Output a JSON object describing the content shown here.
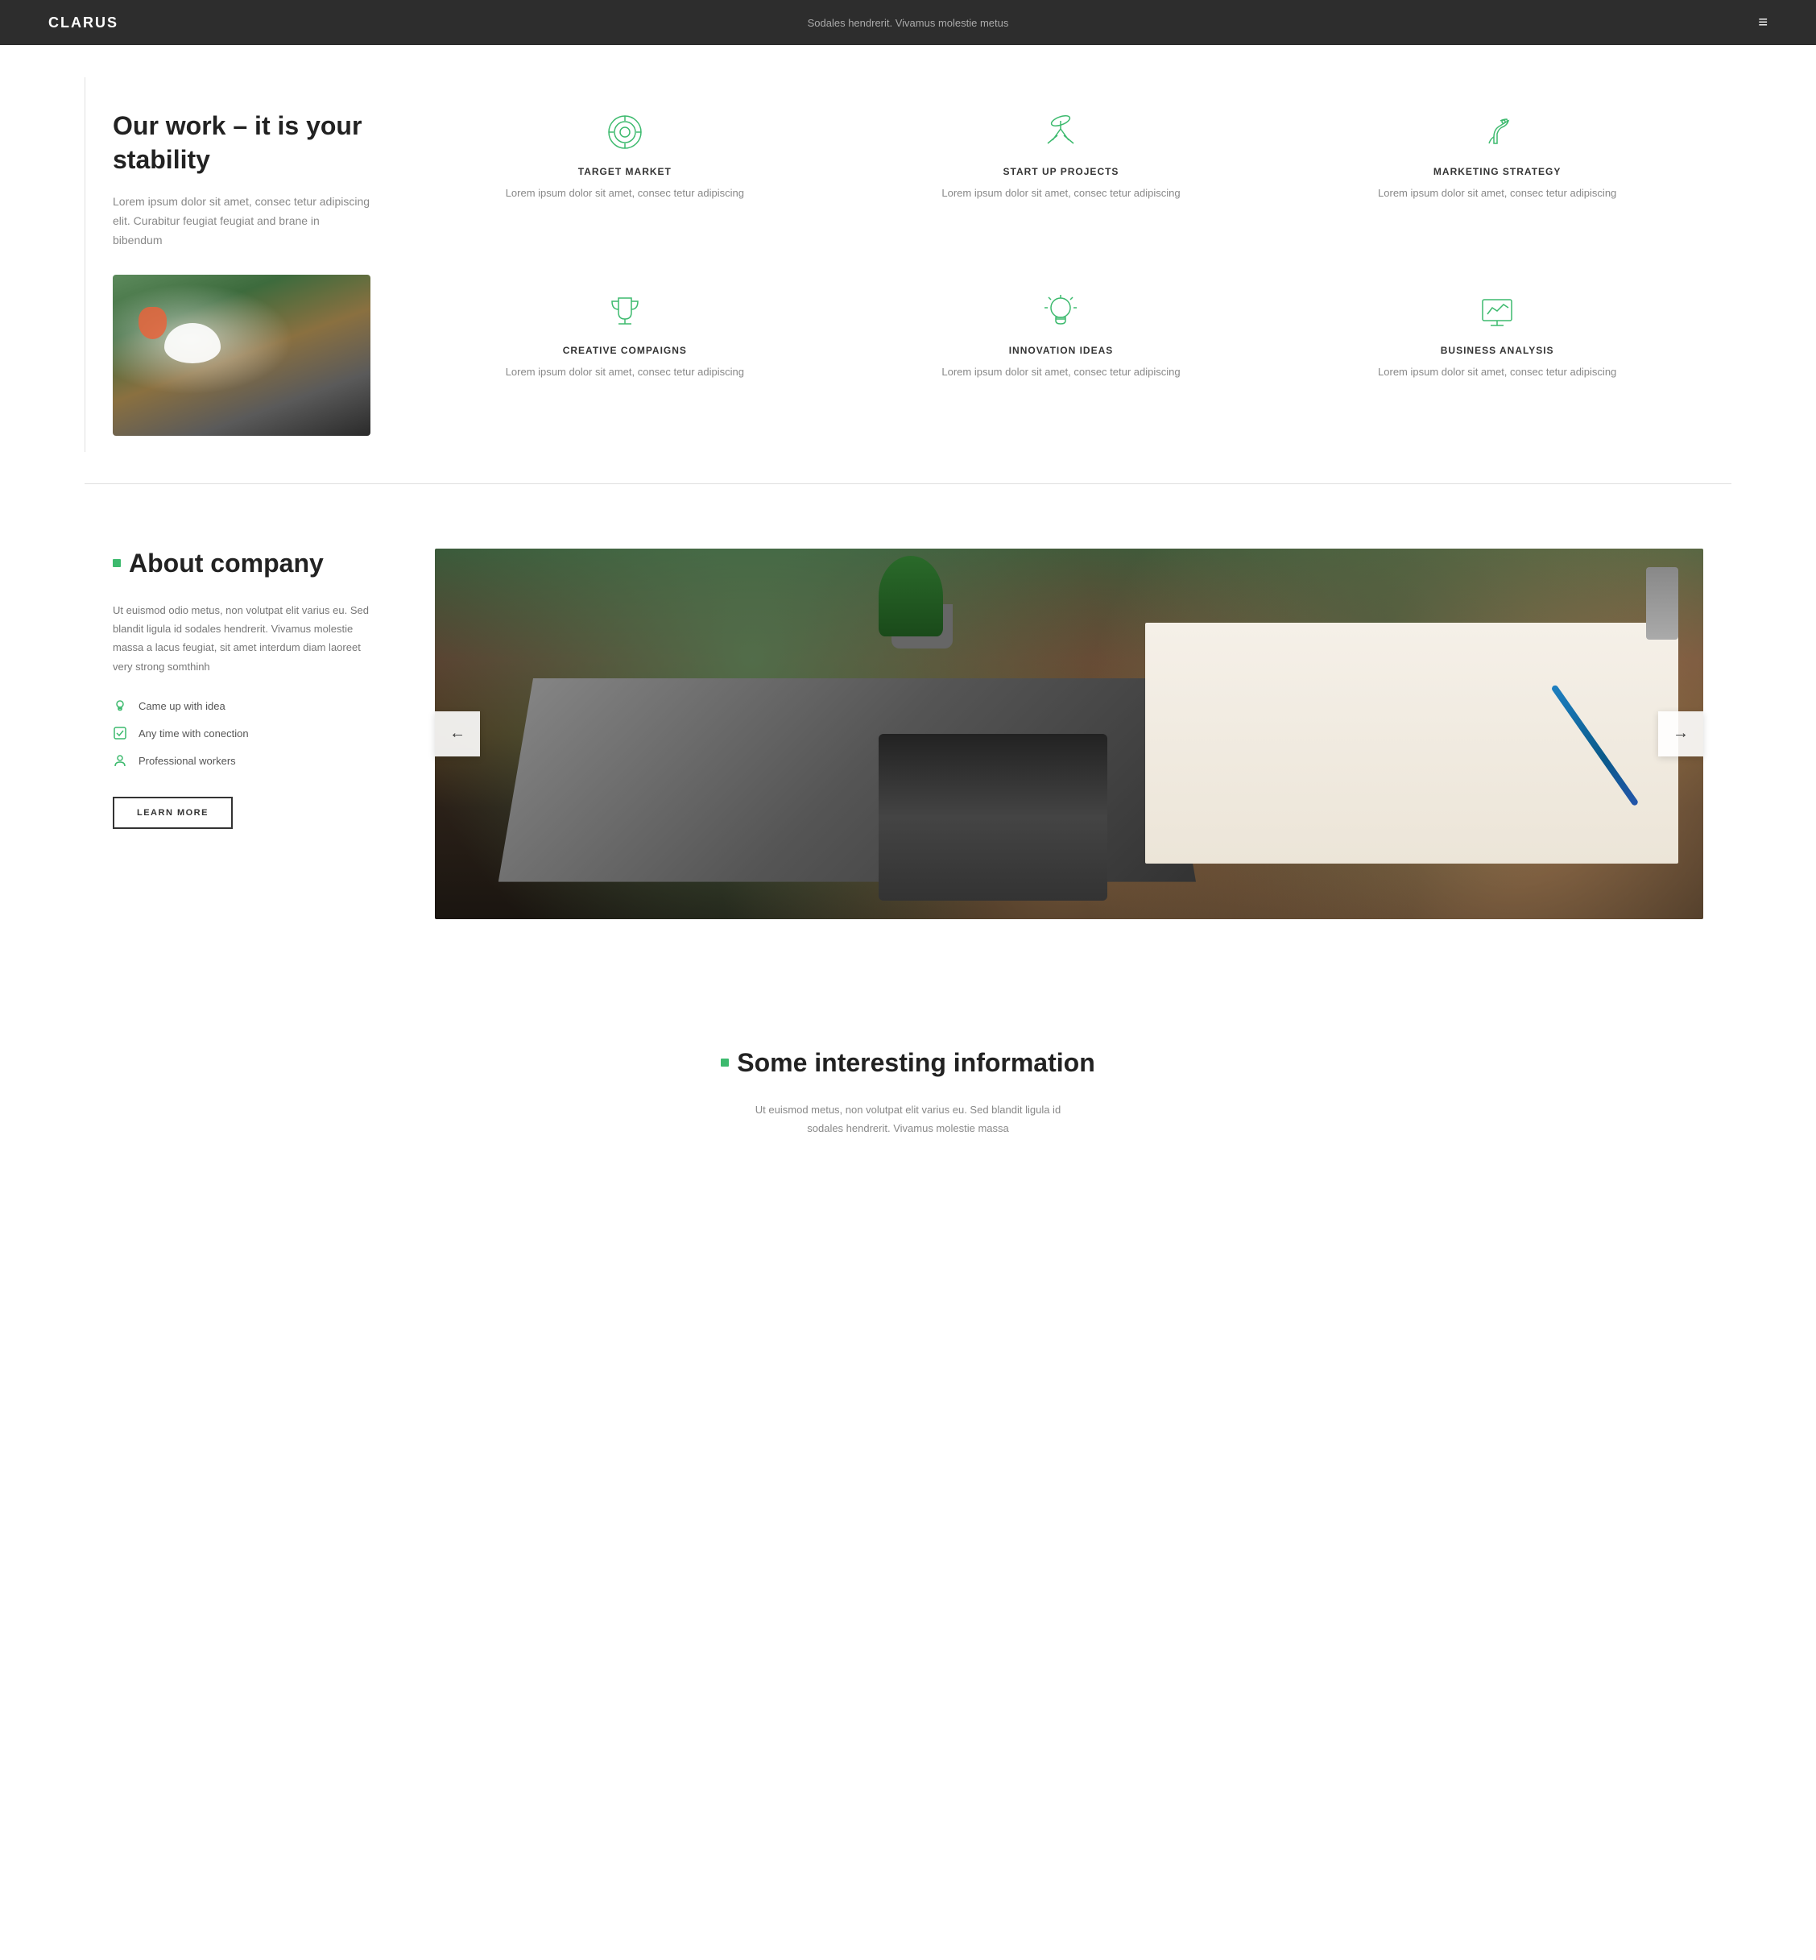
{
  "navbar": {
    "brand": "CLARUS",
    "tagline": "Sodales hendrerit. Vivamus molestie metus",
    "menu_icon": "≡"
  },
  "section_work": {
    "heading": "Our work – it is your stability",
    "description": "Lorem ipsum dolor sit amet, consec tetur adipiscing elit. Curabitur feugiat feugiat and brane in bibendum",
    "features": [
      {
        "id": "target-market",
        "icon": "target",
        "title": "TARGET MARKET",
        "description": "Lorem ipsum dolor sit amet, consec tetur adipiscing"
      },
      {
        "id": "startup-projects",
        "icon": "telescope",
        "title": "START UP PROJECTS",
        "description": "Lorem ipsum dolor sit amet, consec tetur adipiscing"
      },
      {
        "id": "marketing-strategy",
        "icon": "horse",
        "title": "MARKETING STRATEGY",
        "description": "Lorem ipsum dolor sit amet, consec tetur adipiscing"
      },
      {
        "id": "creative-campaigns",
        "icon": "trophy",
        "title": "CREATIVE COMPAIGNS",
        "description": "Lorem ipsum dolor sit amet, consec tetur adipiscing"
      },
      {
        "id": "innovation-ideas",
        "icon": "bulb",
        "title": "INNOVATION IDEAS",
        "description": "Lorem ipsum dolor sit amet, consec tetur adipiscing"
      },
      {
        "id": "business-analysis",
        "icon": "chart",
        "title": "BUSINESS ANALYSIS",
        "description": "Lorem ipsum dolor sit amet, consec tetur adipiscing"
      }
    ]
  },
  "section_about": {
    "title": "About company",
    "description": "Ut euismod odio metus, non volutpat elit varius eu. Sed blandit ligula id sodales hendrerit. Vivamus molestie massa a lacus feugiat, sit amet interdum diam laoreet very strong somthinh",
    "list_items": [
      {
        "icon": "lightbulb",
        "text": "Came up with idea"
      },
      {
        "icon": "checkbox",
        "text": "Any time with conection"
      },
      {
        "icon": "person",
        "text": "Professional workers"
      }
    ],
    "learn_more_label": "LEARN MORE",
    "nav_prev": "←",
    "nav_next": "→"
  },
  "section_info": {
    "title": "Some interesting information",
    "description": "Ut euismod metus, non volutpat elit varius eu. Sed blandit ligula id sodales hendrerit. Vivamus molestie massa"
  },
  "accent_color": "#3dba6e"
}
